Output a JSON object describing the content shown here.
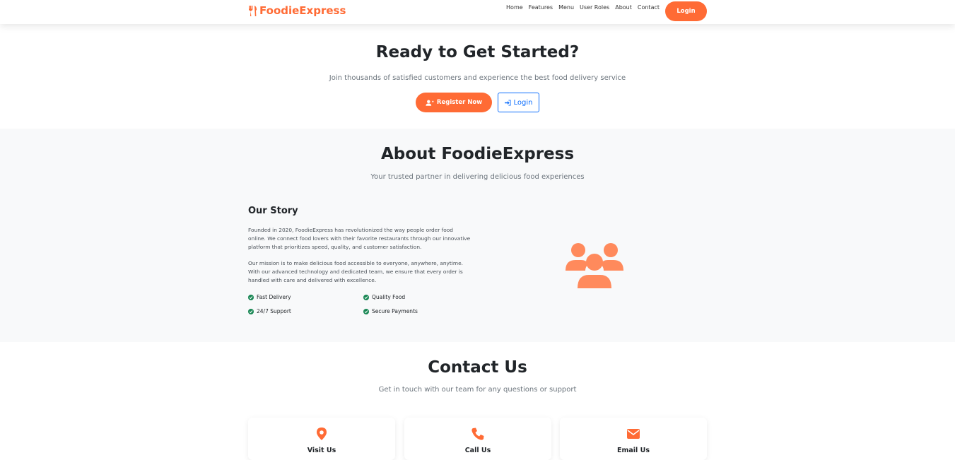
{
  "navbar": {
    "brand": "FoodieExpress",
    "links": [
      "Home",
      "Features",
      "Menu",
      "User Roles",
      "About",
      "Contact"
    ],
    "login": "Login"
  },
  "cta": {
    "title": "Ready to Get Started?",
    "subtitle": "Join thousands of satisfied customers and experience the best food delivery service",
    "register": "Register Now",
    "login": "Login"
  },
  "about": {
    "title": "About FoodieExpress",
    "subtitle": "Your trusted partner in delivering delicious food experiences",
    "story_title": "Our Story",
    "p1": "Founded in 2020, FoodieExpress has revolutionized the way people order food online. We connect food lovers with their favorite restaurants through our innovative platform that prioritizes speed, quality, and customer satisfaction.",
    "p2": "Our mission is to make delicious food accessible to everyone, anywhere, anytime. With our advanced technology and dedicated team, we ensure that every order is handled with care and delivered with excellence.",
    "features": [
      "Fast Delivery",
      "Quality Food",
      "24/7 Support",
      "Secure Payments"
    ],
    "icon": "users-icon"
  },
  "contact": {
    "title": "Contact Us",
    "subtitle": "Get in touch with our team for any questions or support",
    "cards": [
      {
        "icon": "map-marker-icon",
        "title": "Visit Us"
      },
      {
        "icon": "phone-icon",
        "title": "Call Us"
      },
      {
        "icon": "envelope-icon",
        "title": "Email Us"
      }
    ]
  },
  "colors": {
    "accent": "#ff6b35",
    "primary": "#0d6efd",
    "success": "#198754"
  }
}
